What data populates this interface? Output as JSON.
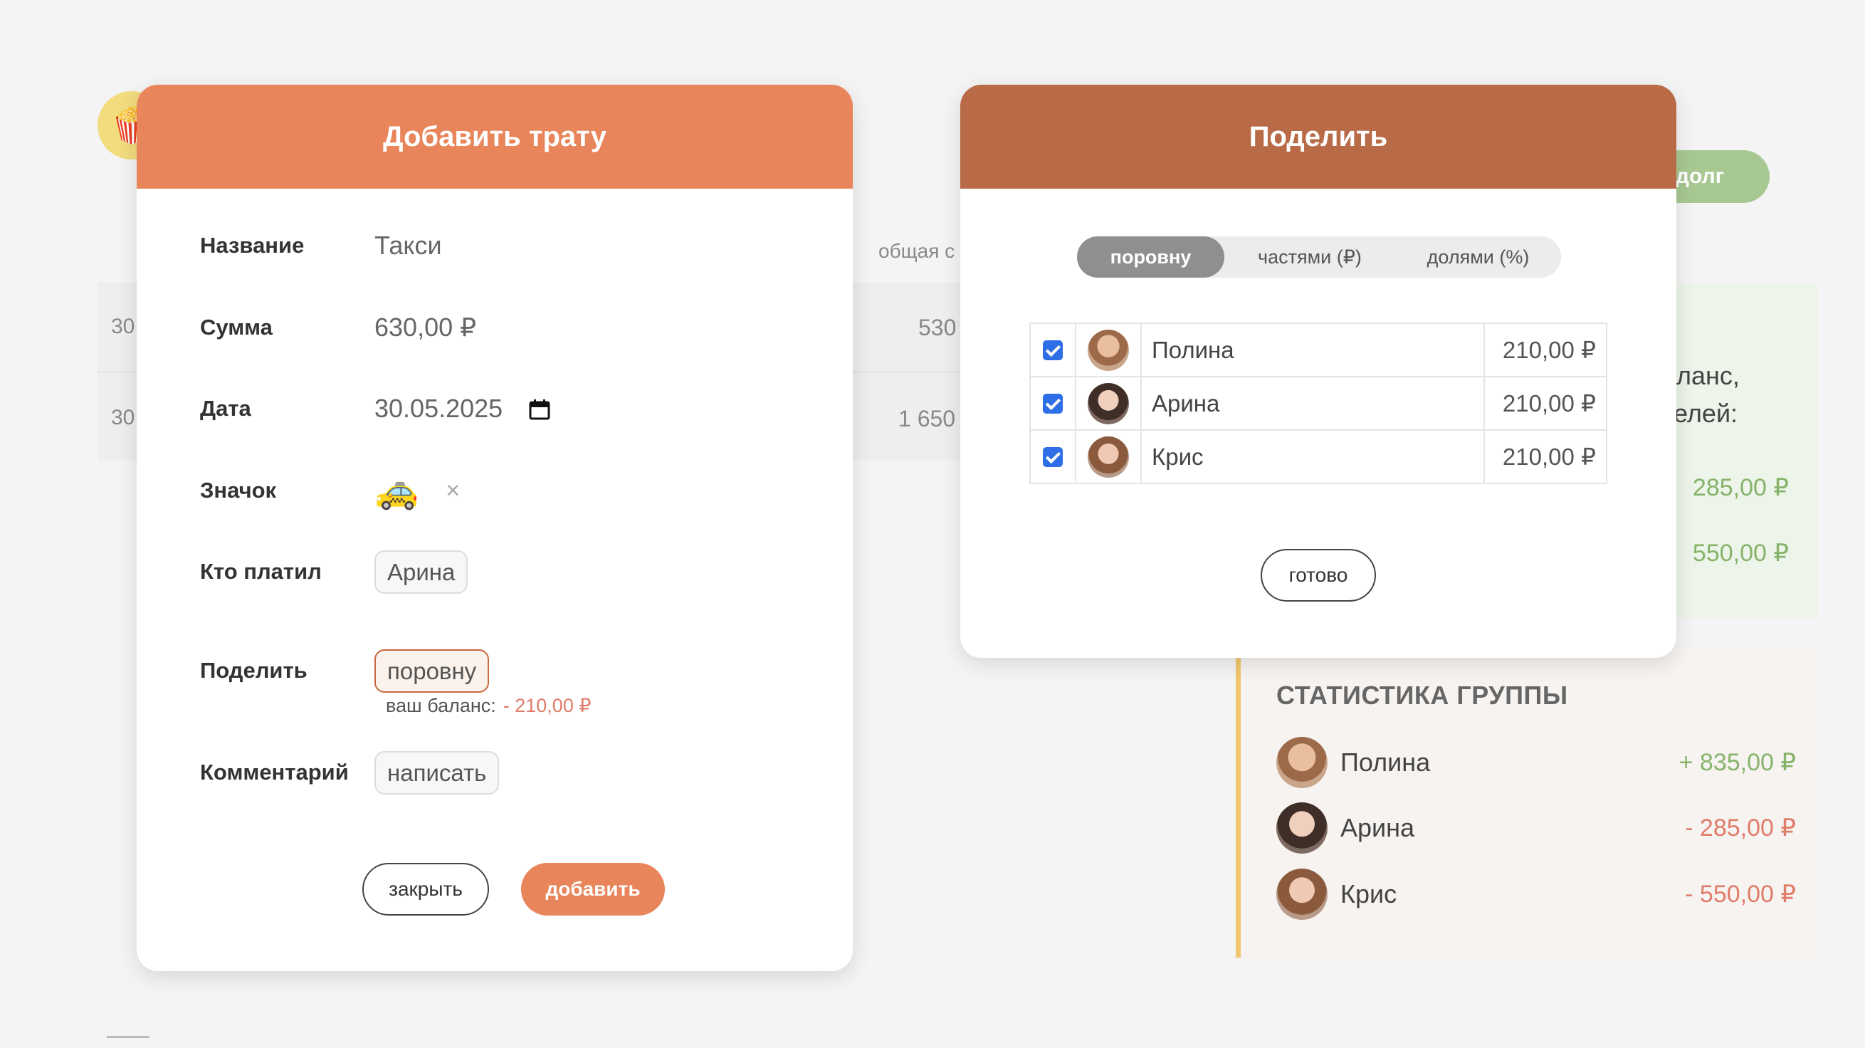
{
  "background": {
    "emoji": "🍿",
    "column_title": "общая с",
    "rows": [
      {
        "left": "30",
        "right": "530"
      },
      {
        "left": "30",
        "right": "1 650"
      }
    ],
    "debt_button": "долг",
    "balance_text_line1": "аланс,",
    "balance_text_line2": "телей:",
    "balance_amounts": [
      "285,00 ₽",
      "550,00 ₽"
    ]
  },
  "stats": {
    "title": "СТАТИСТИКА ГРУППЫ",
    "members": [
      {
        "name": "Полина",
        "amount": "+ 835,00 ₽"
      },
      {
        "name": "Арина",
        "amount": "- 285,00 ₽"
      },
      {
        "name": "Крис",
        "amount": "- 550,00 ₽"
      }
    ]
  },
  "add_modal": {
    "title": "Добавить трату",
    "labels": {
      "name": "Название",
      "amount": "Сумма",
      "date": "Дата",
      "icon": "Значок",
      "payer": "Кто платил",
      "split": "Поделить",
      "comment": "Комментарий"
    },
    "values": {
      "name": "Такси",
      "amount": "630,00 ₽",
      "date": "30.05.2025",
      "icon": "🚕",
      "clear": "×",
      "payer": "Арина",
      "split": "поровну",
      "comment": "написать"
    },
    "balance_label": "ваш баланс:",
    "balance_value": "- 210,00 ₽",
    "close_button": "закрыть",
    "add_button": "добавить"
  },
  "split_modal": {
    "title": "Поделить",
    "modes": [
      "поровну",
      "частями (₽)",
      "долями (%)"
    ],
    "participants": [
      {
        "name": "Полина",
        "amount": "210,00 ₽"
      },
      {
        "name": "Арина",
        "amount": "210,00 ₽"
      },
      {
        "name": "Крис",
        "amount": "210,00 ₽"
      }
    ],
    "done_button": "готово"
  }
}
